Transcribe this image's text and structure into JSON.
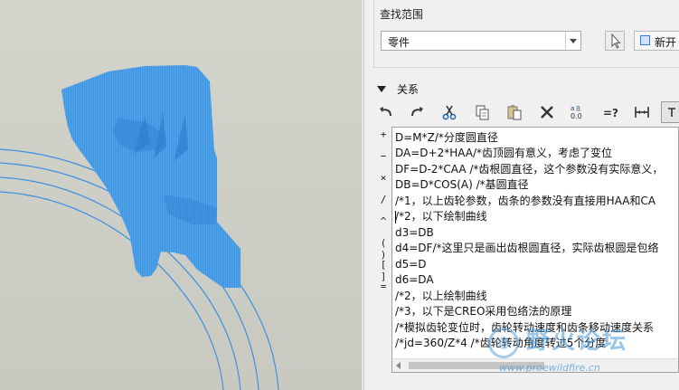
{
  "search_scope": {
    "label": "查找范围",
    "selected": "零件",
    "new_button_label": "新开"
  },
  "relations": {
    "header": "关系",
    "toolbar_icons": [
      "undo-icon",
      "redo-icon",
      "cut-icon",
      "copy-icon",
      "paste-icon",
      "delete-icon",
      "insert-function-icon",
      "evaluate-icon",
      "insert-parameter-icon",
      "sort-icon"
    ],
    "side_operators": [
      "+",
      "−",
      "×",
      "/",
      "^",
      "( )",
      "[ ]",
      "="
    ],
    "lines": [
      "D=M*Z/*分度圆直径",
      "DA=D+2*HAA/*齿顶圆有意义，考虑了变位",
      "DF=D-2*CAA /*齿根圆直径，这个参数没有实际意义，",
      "DB=D*COS(A) /*基圆直径",
      "/*1，以上齿轮参数，齿条的参数没有直接用HAA和CA",
      "/*2，以下绘制曲线",
      "d3=DB",
      "d4=DF/*这里只是画出齿根圆直径，实际齿根圆是包络",
      "d5=D",
      "d6=DA",
      "/*2，以上绘制曲线",
      "/*3，以下是CREO采用包络法的原理",
      "/*模拟齿轮变位时，齿轮转动速度和齿条移动速度关系",
      "/*jd=360/Z*4 /*齿轮转动角度转过5个分度"
    ]
  },
  "watermark": {
    "title": "野火论坛",
    "url": "www.proewildfire.cn"
  },
  "colors": {
    "model_blue": "#3d96e3",
    "viewport_bg": "#cfd0c8",
    "panel_bg": "#f0f0f0"
  }
}
